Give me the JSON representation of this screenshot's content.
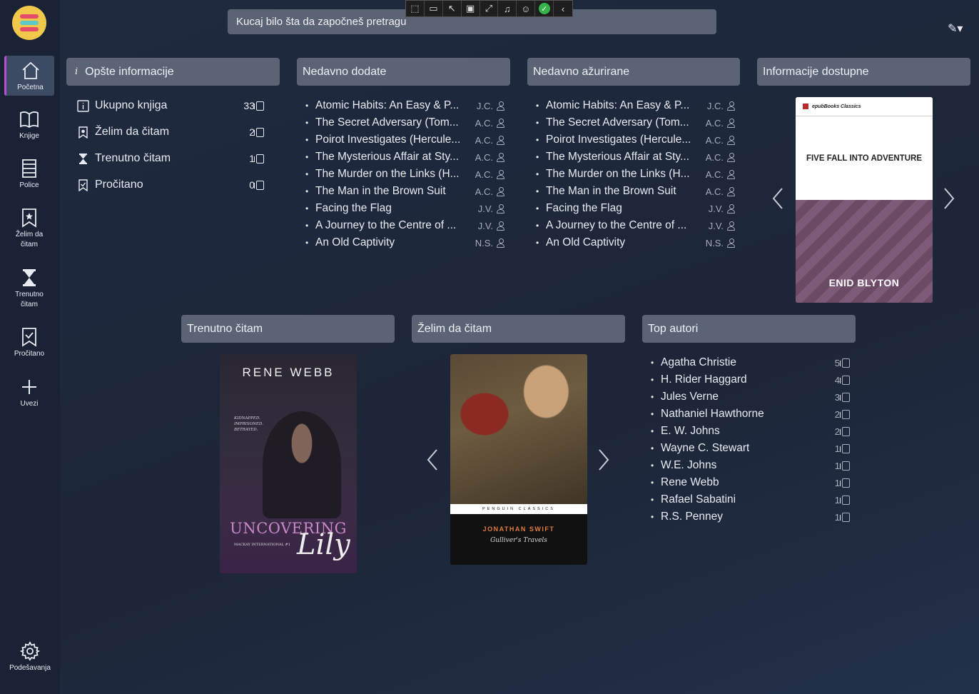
{
  "search": {
    "placeholder": "Kucaj bilo šta da započneš pretragu"
  },
  "sidebar": {
    "items": [
      {
        "label": "Početna",
        "icon": "home-icon"
      },
      {
        "label": "Knjige",
        "icon": "book-open-icon"
      },
      {
        "label": "Police",
        "icon": "shelf-icon"
      },
      {
        "label": "Želim da čitam",
        "icon": "bookmark-star-icon"
      },
      {
        "label": "Trenutno čitam",
        "icon": "hourglass-icon"
      },
      {
        "label": "Pročitano",
        "icon": "bookmark-check-icon"
      },
      {
        "label": "Uvezi",
        "icon": "plus-icon"
      }
    ],
    "settings_label": "Podešavanja"
  },
  "general": {
    "header": "Opšte informacije",
    "rows": [
      {
        "label": "Ukupno knjiga",
        "count": "33"
      },
      {
        "label": "Želim da čitam",
        "count": "2"
      },
      {
        "label": "Trenutno čitam",
        "count": "1"
      },
      {
        "label": "Pročitano",
        "count": "0"
      }
    ]
  },
  "recently_added": {
    "header": "Nedavno dodate",
    "items": [
      {
        "title": "Atomic Habits: An Easy & P...",
        "author": "J.C."
      },
      {
        "title": "The Secret Adversary (Tom...",
        "author": "A.C."
      },
      {
        "title": "Poirot Investigates (Hercule...",
        "author": "A.C."
      },
      {
        "title": "The Mysterious Affair at Sty...",
        "author": "A.C."
      },
      {
        "title": "The Murder on the Links (H...",
        "author": "A.C."
      },
      {
        "title": "The Man in the Brown Suit",
        "author": "A.C."
      },
      {
        "title": "Facing the Flag",
        "author": "J.V."
      },
      {
        "title": "A Journey to the Centre of ...",
        "author": "J.V."
      },
      {
        "title": "An Old Captivity",
        "author": "N.S."
      }
    ]
  },
  "recently_updated": {
    "header": "Nedavno ažurirane",
    "items": [
      {
        "title": "Atomic Habits: An Easy & P...",
        "author": "J.C."
      },
      {
        "title": "The Secret Adversary (Tom...",
        "author": "A.C."
      },
      {
        "title": "Poirot Investigates (Hercule...",
        "author": "A.C."
      },
      {
        "title": "The Mysterious Affair at Sty...",
        "author": "A.C."
      },
      {
        "title": "The Murder on the Links (H...",
        "author": "A.C."
      },
      {
        "title": "The Man in the Brown Suit",
        "author": "A.C."
      },
      {
        "title": "Facing the Flag",
        "author": "J.V."
      },
      {
        "title": "A Journey to the Centre of ...",
        "author": "J.V."
      },
      {
        "title": "An Old Captivity",
        "author": "N.S."
      }
    ]
  },
  "info_available": {
    "header": "Informacije dostupne",
    "cover": {
      "publisher": "epubBooks Classics",
      "title": "FIVE FALL INTO ADVENTURE",
      "author": "ENID BLYTON"
    }
  },
  "currently_reading": {
    "header": "Trenutno čitam",
    "cover": {
      "author": "RENE  WEBB",
      "tagline": "KIDNAPPED. IMPRISONED. BETRAYED.",
      "title_top": "UNCOVERING",
      "title_script": "Lily",
      "series": "MACKAY INTERNATIONAL #1"
    }
  },
  "want_to_read": {
    "header": "Želim da čitam",
    "cover": {
      "imprint": "PENGUIN  CLASSICS",
      "author": "JONATHAN SWIFT",
      "title": "Gulliver's Travels"
    }
  },
  "top_authors": {
    "header": "Top autori",
    "items": [
      {
        "name": "Agatha Christie",
        "count": "5"
      },
      {
        "name": "H. Rider Haggard",
        "count": "4"
      },
      {
        "name": "Jules Verne",
        "count": "3"
      },
      {
        "name": "Nathaniel Hawthorne",
        "count": "2"
      },
      {
        "name": "E. W. Johns",
        "count": "2"
      },
      {
        "name": "Wayne C. Stewart",
        "count": "1"
      },
      {
        "name": "W.E. Johns",
        "count": "1"
      },
      {
        "name": "Rene Webb",
        "count": "1"
      },
      {
        "name": "Rafael Sabatini",
        "count": "1"
      },
      {
        "name": "R.S. Penney",
        "count": "1"
      }
    ]
  },
  "colors": {
    "accent": "#b94fd0",
    "panel_header": "#5b6475",
    "logo": "#f2c84b"
  }
}
